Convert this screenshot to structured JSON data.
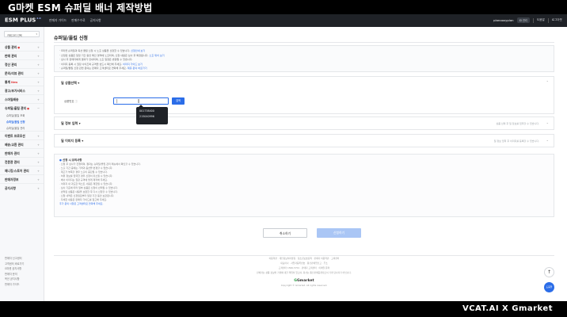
{
  "video_title": "G마켓 ESM 슈퍼딜 배너 제작방법",
  "header": {
    "logo": "ESM PLUS",
    "logo_sup": "2.0",
    "nav": [
      "판매자 가이드",
      "판매수수료",
      "공지사항"
    ],
    "account": "planooxyplan",
    "chip": "ID 관리",
    "links": [
      "도움말",
      "로그아웃"
    ]
  },
  "sidebar": {
    "select_label": "카테고리 선택",
    "items": [
      {
        "label": "상품 관리",
        "badge": "●"
      },
      {
        "label": "판매 관리"
      },
      {
        "label": "정산 관리"
      },
      {
        "label": "문의/리뷰 관리"
      },
      {
        "label": "통계",
        "badge": "New"
      },
      {
        "label": "광고/부가서비스"
      },
      {
        "label": "스마일배송"
      },
      {
        "label": "슈퍼딜/올킬 관리",
        "badge": "●"
      }
    ],
    "subs": [
      "슈퍼딜/올킬 조회",
      "슈퍼딜/올킬 신청",
      "슈퍼딜/올킬 관리"
    ],
    "active_sub": 1,
    "items2": [
      {
        "label": "이벤트 프로모션"
      },
      {
        "label": "배송/교환 관리"
      },
      {
        "label": "판매자 관리"
      },
      {
        "label": "전문관 관리"
      },
      {
        "label": "매니징/스토어 관리"
      },
      {
        "label": "판매자정보"
      },
      {
        "label": "공지사항"
      }
    ],
    "footer": [
      "판매자 신고센터",
      "고객센터 바로가기",
      "G마켓 공지사항",
      "판매자 문의",
      "옥션 공지사항",
      "판매자 가이드"
    ]
  },
  "page": {
    "title": "슈퍼딜/올킬 신청",
    "notice_lines": [
      {
        "text": "G마켓 슈퍼딜과 옥션 올킬 신청 시 노출 상품을 선정할 수 있습니다.",
        "link": "신청안내 보기"
      },
      {
        "text": "선정된 상품은 일정 기간 동안 메인 영역에 노출되며, 신청 내용은 심사 후 확정됩니다.",
        "link": "노출 위치 보기"
      },
      {
        "text": "심사 후 판매자에게 결과가 안내되며, 노출 일정은 변경될 수 있습니다.",
        "link": ""
      },
      {
        "text": "이미지 등록 시 권장 사이즈와 규격을 반드시 확인해 주세요.",
        "link": "이미지 가이드 보기"
      },
      {
        "text": "슈퍼딜/올킬 신청 관련 문의는 판매자 고객센터로 연락해 주세요.",
        "link": "제휴 문의 바로가기"
      }
    ],
    "section1": {
      "title": "딜 상품선택",
      "field_label": "상품번호",
      "search_btn": "검색"
    },
    "dropdown": [
      "001738400",
      "215040996"
    ],
    "section2": {
      "title": "딜 정보 입력",
      "note": "상품 선택 후 딜 정보를 입력할 수 있습니다."
    },
    "section3": {
      "title": "딜 이미지 등록",
      "note": "딜 정보 입력 후 이미지를 등록할 수 있습니다."
    },
    "info_title": "신청 시 유의사항",
    "info_lines": [
      "· 신청 후 심사가 진행되며, 결과는 슈퍼딜/올킬 관리 메뉴에서 확인할 수 있습니다.",
      "· 노출 기간 중에는 가격과 옵션을 변경할 수 없습니다.",
      "· 재고가 부족할 경우 노출이 중단될 수 있습니다.",
      "· 허위 정보를 입력한 경우 신청이 취소될 수 있습니다.",
      "· 배너 이미지는 권장 규격에 맞게 제작해 주세요.",
      "· 이미지 내 과도한 텍스트 사용은 제한될 수 있습니다.",
      "· 심사 기준에 따라 일부 상품은 신청이 반려될 수 있습니다.",
      "· 반려된 상품은 내용을 보완한 후 다시 신청할 수 있습니다.",
      "· 신청 내역은 신청일로부터 일정 기간 동안 보관됩니다.",
      "· 자세한 내용은 판매자 가이드를 참고해 주세요."
    ],
    "info_blue": "추가 문의 사항은 고객센터로 연락해 주세요.",
    "cancel_label": "취소하기",
    "submit_label": "신청하기"
  },
  "footer": {
    "lines": [
      "이용약관 · 개인정보처리방침 · 청소년보호정책 · 판매자 이용약관 · 고객센터",
      "대표이사 · 사업자등록번호 · 통신판매업신고 · 주소",
      "고객센터 1566-5701 · 판매자 고객센터 · 이메일 문의",
      "판매자는 상품 정보와 거래에 대한 책임이 있으며, 회사는 통신판매중개자로서 거래 당사자가 아닙니다."
    ],
    "brand": "Gmarket",
    "copyright": "Copyright © Gmarket. All rights reserved."
  },
  "fab": {
    "top": "↑",
    "help": "도움말"
  },
  "watermark": "VCAT.AI  X  Gmarket"
}
